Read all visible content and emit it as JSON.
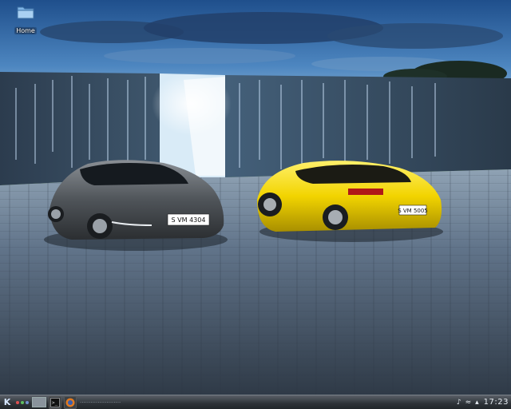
{
  "desktop": {
    "icons": [
      {
        "label": "Home",
        "icon": "home-folder-icon"
      }
    ]
  },
  "wallpaper": {
    "plates": {
      "gray": "S VM 4304",
      "yellow": "S VM 5005"
    }
  },
  "taskbar": {
    "start_icon": "kde-menu-icon",
    "pager_colors": [
      "#e05050",
      "#60c060",
      "#7090d0"
    ],
    "tasks": [
      {
        "icon": "terminal-icon"
      },
      {
        "icon": "browser-icon"
      }
    ],
    "task_text": "·······················",
    "tray": {
      "volume_icon": "♪",
      "network_icon": "≈",
      "expand_icon": "▴",
      "clock": "17:23"
    }
  }
}
